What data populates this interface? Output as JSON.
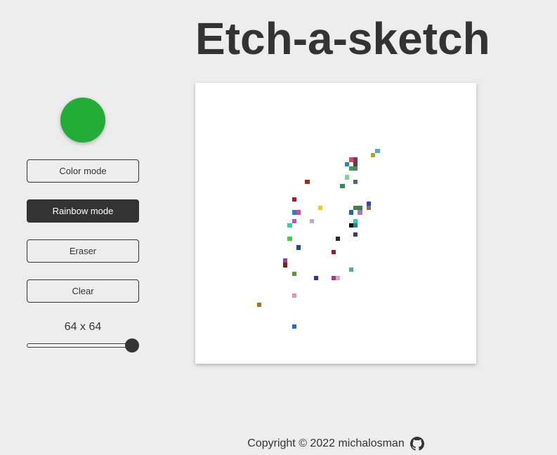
{
  "header": {
    "title": "Etch-a-sketch"
  },
  "controls": {
    "color_picker": {
      "value": "#21ad37"
    },
    "buttons": [
      {
        "id": "color-mode",
        "label": "Color mode",
        "active": false
      },
      {
        "id": "rainbow-mode",
        "label": "Rainbow mode",
        "active": true
      },
      {
        "id": "eraser",
        "label": "Eraser",
        "active": false
      },
      {
        "id": "clear",
        "label": "Clear",
        "active": false
      }
    ],
    "size_label": "64 x 64",
    "size_slider": {
      "min": 1,
      "max": 64,
      "value": 64
    }
  },
  "board": {
    "grid_size": 64,
    "background": "#ffffff",
    "painted_cells": [
      {
        "col": 41,
        "row": 15,
        "color": "#5ba8b8"
      },
      {
        "col": 40,
        "row": 16,
        "color": "#a8a81a"
      },
      {
        "col": 35,
        "row": 17,
        "color": "#e04848"
      },
      {
        "col": 36,
        "row": 17,
        "color": "#5a3aa0"
      },
      {
        "col": 34,
        "row": 18,
        "color": "#1a8abf"
      },
      {
        "col": 36,
        "row": 18,
        "color": "#7a3a1a"
      },
      {
        "col": 35,
        "row": 19,
        "color": "#3a9a6a"
      },
      {
        "col": 36,
        "row": 19,
        "color": "#4a8a5a"
      },
      {
        "col": 34,
        "row": 21,
        "color": "#8ad08a"
      },
      {
        "col": 25,
        "row": 22,
        "color": "#8a3a1a"
      },
      {
        "col": 36,
        "row": 22,
        "color": "#4a6a8a"
      },
      {
        "col": 33,
        "row": 23,
        "color": "#2a8a6a"
      },
      {
        "col": 22,
        "row": 26,
        "color": "#c0102a"
      },
      {
        "col": 39,
        "row": 27,
        "color": "#1a4ad0"
      },
      {
        "col": 28,
        "row": 28,
        "color": "#e0d01a"
      },
      {
        "col": 36,
        "row": 28,
        "color": "#3a8a3a"
      },
      {
        "col": 37,
        "row": 28,
        "color": "#4a7a4a"
      },
      {
        "col": 39,
        "row": 28,
        "color": "#9a6a4a"
      },
      {
        "col": 22,
        "row": 29,
        "color": "#1a8ac0"
      },
      {
        "col": 23,
        "row": 29,
        "color": "#e040a0"
      },
      {
        "col": 35,
        "row": 29,
        "color": "#1a6ab0"
      },
      {
        "col": 37,
        "row": 29,
        "color": "#a07ad0"
      },
      {
        "col": 22,
        "row": 31,
        "color": "#c050d0"
      },
      {
        "col": 26,
        "row": 31,
        "color": "#b0b0e8"
      },
      {
        "col": 36,
        "row": 31,
        "color": "#2ad0a0"
      },
      {
        "col": 21,
        "row": 32,
        "color": "#1ae0a0"
      },
      {
        "col": 35,
        "row": 32,
        "color": "#000000"
      },
      {
        "col": 36,
        "row": 32,
        "color": "#1a8a8a"
      },
      {
        "col": 36,
        "row": 34,
        "color": "#3a3a7a"
      },
      {
        "col": 21,
        "row": 35,
        "color": "#2ae02a"
      },
      {
        "col": 32,
        "row": 35,
        "color": "#3a1a4a"
      },
      {
        "col": 23,
        "row": 37,
        "color": "#1a4a9a"
      },
      {
        "col": 31,
        "row": 38,
        "color": "#9a1a3a"
      },
      {
        "col": 20,
        "row": 40,
        "color": "#7a4ab0"
      },
      {
        "col": 20,
        "row": 41,
        "color": "#8a1a1a"
      },
      {
        "col": 35,
        "row": 42,
        "color": "#4ab08a"
      },
      {
        "col": 22,
        "row": 43,
        "color": "#5a9a3a"
      },
      {
        "col": 27,
        "row": 44,
        "color": "#3a2ab0"
      },
      {
        "col": 31,
        "row": 44,
        "color": "#9a3a8a"
      },
      {
        "col": 32,
        "row": 44,
        "color": "#e0a0d0"
      },
      {
        "col": 22,
        "row": 48,
        "color": "#e890b0"
      },
      {
        "col": 14,
        "row": 50,
        "color": "#a07a1a"
      },
      {
        "col": 22,
        "row": 55,
        "color": "#1a6ae0"
      }
    ]
  },
  "footer": {
    "copyright": "Copyright © 2022 michalosman",
    "icon": "github-icon"
  }
}
